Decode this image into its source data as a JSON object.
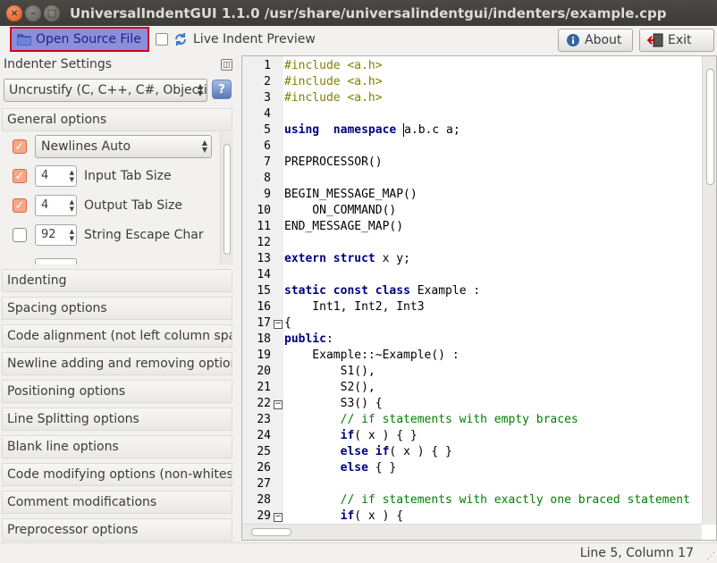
{
  "window": {
    "title": "UniversalIndentGUI 1.1.0 /usr/share/universalindentgui/indenters/example.cpp",
    "close_glyph": "×",
    "minimize_glyph": "–",
    "maximize_glyph": "□"
  },
  "toolbar": {
    "open_label": "Open Source File",
    "live_label": "Live Indent Preview",
    "about_label": "About",
    "exit_label": "Exit"
  },
  "sidebar": {
    "title": "Indenter Settings",
    "indenter": "Uncrustify (C, C++, C#, Objective-C, D, Java, Pawn, VALA)",
    "categories": [
      "General options",
      "Indenting",
      "Spacing options",
      "Code alignment (not left column spaces/tabs)",
      "Newline adding and removing options",
      "Positioning options",
      "Line Splitting options",
      "Blank line options",
      "Code modifying options (non-whitespace)",
      "Comment modifications",
      "Preprocessor options"
    ],
    "general": {
      "newlines": {
        "checked": true,
        "value": "Newlines Auto"
      },
      "input_tab": {
        "checked": true,
        "value": "4",
        "label": "Input Tab Size"
      },
      "output_tab": {
        "checked": true,
        "value": "4",
        "label": "Output Tab Size"
      },
      "string_escape": {
        "checked": false,
        "value": "92",
        "label": "String Escape Char"
      }
    }
  },
  "editor": {
    "line_numbers": [
      "1",
      "2",
      "3",
      "4",
      "5",
      "6",
      "7",
      "8",
      "9",
      "10",
      "11",
      "12",
      "13",
      "14",
      "15",
      "16",
      "17",
      "18",
      "19",
      "20",
      "21",
      "22",
      "23",
      "24",
      "25",
      "26",
      "27",
      "28",
      "29"
    ],
    "fold_lines": [
      17,
      22,
      29
    ],
    "lines": [
      [
        [
          "pp",
          "#include <a.h>"
        ]
      ],
      [
        [
          "pp",
          "#include <a.h>"
        ]
      ],
      [
        [
          "pp",
          "#include <a.h>"
        ]
      ],
      [],
      [
        [
          "kw",
          "using"
        ],
        [
          "",
          "  "
        ],
        [
          "kw",
          "namespace"
        ],
        [
          "",
          " "
        ],
        [
          "caret",
          "a.b.c a;"
        ]
      ],
      [],
      [
        [
          "",
          "PREPROCESSOR()"
        ]
      ],
      [],
      [
        [
          "",
          "BEGIN_MESSAGE_MAP()"
        ]
      ],
      [
        [
          "",
          "    ON_COMMAND()"
        ]
      ],
      [
        [
          "",
          "END_MESSAGE_MAP()"
        ]
      ],
      [],
      [
        [
          "kw",
          "extern"
        ],
        [
          "",
          " "
        ],
        [
          "kw",
          "struct"
        ],
        [
          "",
          " x y;"
        ]
      ],
      [],
      [
        [
          "kw",
          "static"
        ],
        [
          "",
          " "
        ],
        [
          "kw",
          "const"
        ],
        [
          "",
          " "
        ],
        [
          "kw",
          "class"
        ],
        [
          "",
          " Example :"
        ]
      ],
      [
        [
          "",
          "    Int1, Int2, Int3"
        ]
      ],
      [
        [
          "",
          "{"
        ]
      ],
      [
        [
          "kw",
          "public"
        ],
        [
          "",
          ":"
        ]
      ],
      [
        [
          "",
          "    Example::~Example() :"
        ]
      ],
      [
        [
          "",
          "        S1(),"
        ]
      ],
      [
        [
          "",
          "        S2(),"
        ]
      ],
      [
        [
          "",
          "        S3() {"
        ]
      ],
      [
        [
          "",
          "        "
        ],
        [
          "cm",
          "// if statements with empty braces"
        ]
      ],
      [
        [
          "",
          "        "
        ],
        [
          "kw",
          "if"
        ],
        [
          "",
          "( x ) { }"
        ]
      ],
      [
        [
          "",
          "        "
        ],
        [
          "kw",
          "else"
        ],
        [
          "",
          " "
        ],
        [
          "kw",
          "if"
        ],
        [
          "",
          "( x ) { }"
        ]
      ],
      [
        [
          "",
          "        "
        ],
        [
          "kw",
          "else"
        ],
        [
          "",
          " { }"
        ]
      ],
      [],
      [
        [
          "",
          "        "
        ],
        [
          "cm",
          "// if statements with exactly one braced statement"
        ]
      ],
      [
        [
          "",
          "        "
        ],
        [
          "kw",
          "if"
        ],
        [
          "",
          "( x ) {"
        ]
      ]
    ]
  },
  "status": {
    "position": "Line 5, Column 17"
  },
  "colors": {
    "preprocessor": "#808000",
    "keyword": "#000080",
    "comment": "#008000",
    "highlight_border": "#d10018",
    "checkbox_accent": "#e95420"
  }
}
